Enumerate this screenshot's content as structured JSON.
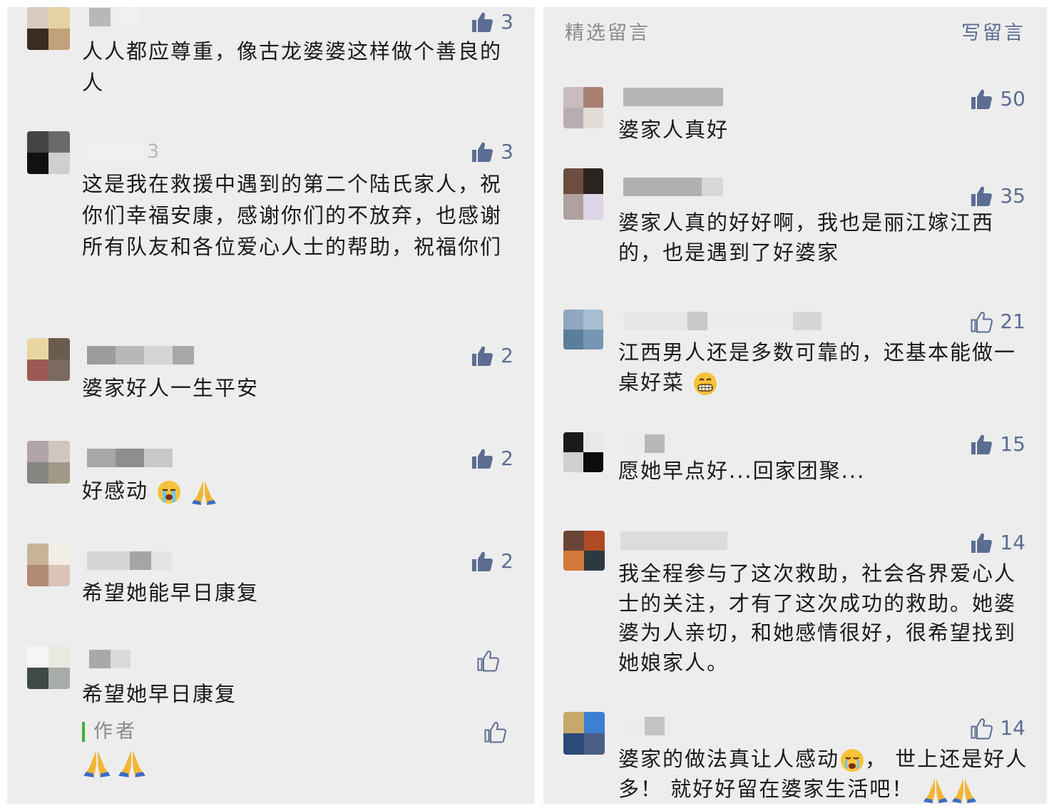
{
  "header": {
    "title": "精选留言",
    "write_label": "写留言"
  },
  "colors": {
    "accent": "#5b6d92",
    "author_bar": "#3cb034",
    "panel_bg": "#ededed"
  },
  "left_comments": [
    {
      "nickname": "",
      "text": "人人都应尊重，像古龙婆婆这样做个善良的人",
      "likes": "3",
      "liked": true,
      "avatar": [
        "#d9c9c0",
        "#e6d2a0",
        "#3b2b22",
        "#c2a27a"
      ]
    },
    {
      "nickname": "3",
      "text": "这是我在救援中遇到的第二个陆氏家人，祝你们幸福安康，感谢你们的不放弃，也感谢所有队友和各位爱心人士的帮助，祝福你们",
      "likes": "3",
      "liked": true,
      "avatar": [
        "#444444",
        "#6a6a6a",
        "#111111",
        "#cfcfcf"
      ]
    },
    {
      "nickname": "",
      "text": "婆家好人一生平安",
      "likes": "2",
      "liked": true,
      "avatar": [
        "#e8d7a0",
        "#6b5b4d",
        "#9c5a56",
        "#7a6a60"
      ]
    },
    {
      "nickname": "",
      "text": "好感动",
      "likes": "2",
      "liked": true,
      "avatar": [
        "#b0a4a8",
        "#d0c6bf",
        "#858582",
        "#a29a88"
      ]
    },
    {
      "nickname": "",
      "text": "希望她能早日康复",
      "likes": "2",
      "liked": true,
      "avatar": [
        "#c7b497",
        "#f2ede6",
        "#b08a72",
        "#d9c4b6"
      ]
    },
    {
      "nickname": "",
      "text": "希望她早日康复",
      "likes": "",
      "liked": false,
      "avatar": [
        "#f5f5f5",
        "#e9e9e2",
        "#3e4a44",
        "#a8aca8"
      ],
      "author_tag": "作者"
    }
  ],
  "right_comments": [
    {
      "nickname": "",
      "text": "婆家人真好",
      "likes": "50",
      "liked": true,
      "avatar": [
        "#c8bcbf",
        "#a88072",
        "#b8aeb2",
        "#e3dcd6"
      ]
    },
    {
      "nickname": "",
      "text": "婆家人真的好好啊，我也是丽江嫁江西的，也是遇到了好婆家",
      "likes": "35",
      "liked": true,
      "avatar": [
        "#6b4e40",
        "#2b2320",
        "#b0a0a0",
        "#dcd6e6"
      ]
    },
    {
      "nickname": "",
      "text": "江西男人还是多数可靠的，还基本能做一桌好菜",
      "likes": "21",
      "liked": false,
      "avatar": [
        "#8fa7bf",
        "#a7bed0",
        "#5a7f9d",
        "#7796b3"
      ]
    },
    {
      "nickname": "",
      "text": "愿她早点好...回家团聚...",
      "likes": "15",
      "liked": true,
      "avatar": [
        "#1a1a1a",
        "#e8e8e8",
        "#cfcfcf",
        "#0c0c0c"
      ]
    },
    {
      "nickname": "",
      "text": "我全程参与了这次救助，社会各界爱心人士的关注，才有了这次成功的救助。她婆婆为人亲切，和她感情很好，很希望找到她娘家人。",
      "likes": "14",
      "liked": true,
      "avatar": [
        "#6b4438",
        "#b04a25",
        "#d07a3a",
        "#2a3a40"
      ]
    },
    {
      "nickname": "",
      "text_a": "婆家的做法真让人感动",
      "text_b": "， 世上还是好人多！ 就好好留在婆家生活吧！",
      "likes": "14",
      "liked": false,
      "avatar": [
        "#c7a86a",
        "#3d7fd0",
        "#2c4a78",
        "#4a5e86"
      ]
    }
  ]
}
